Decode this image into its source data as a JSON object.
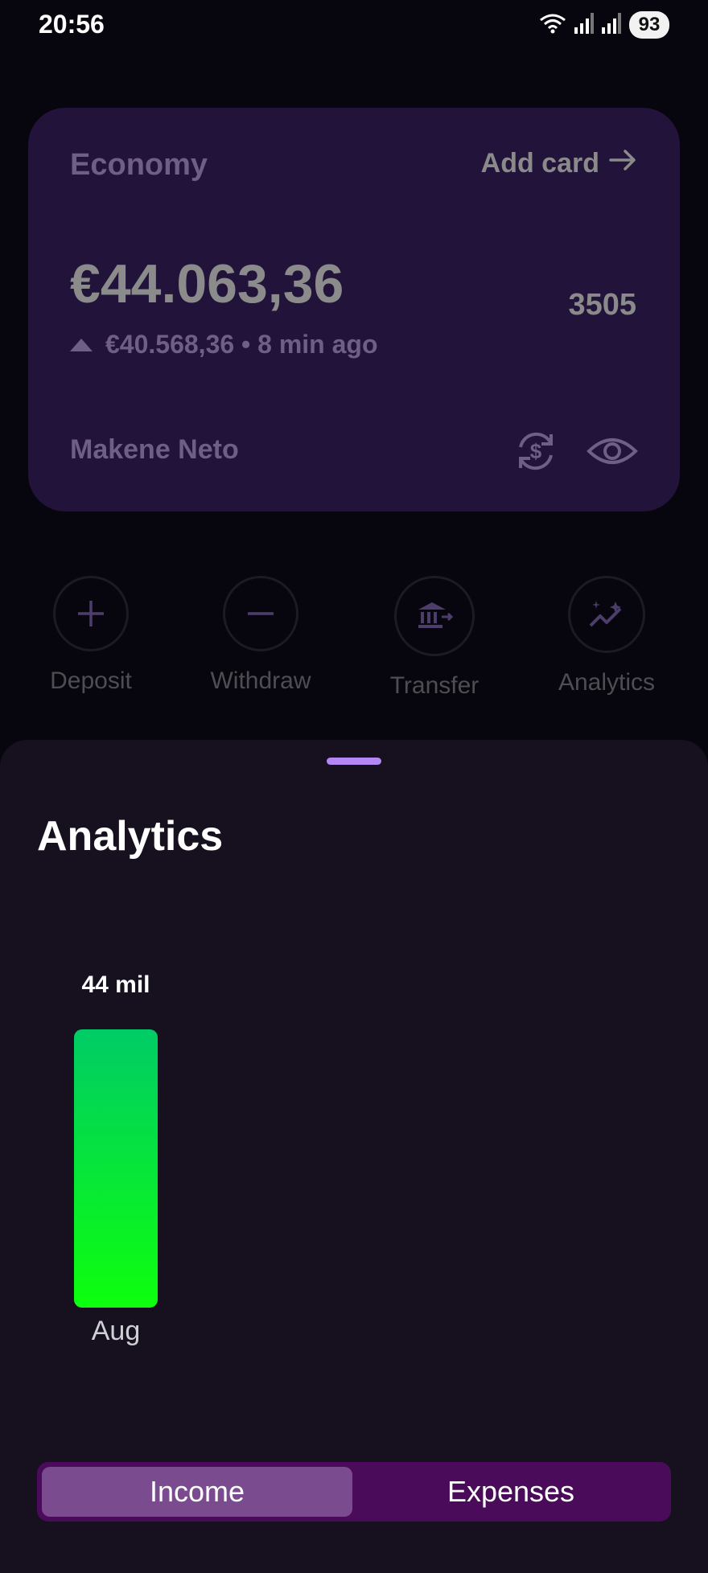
{
  "status_bar": {
    "time": "20:56",
    "battery": "93"
  },
  "card": {
    "title": "Economy",
    "add_card_label": "Add card",
    "balance": "€44.063,36",
    "change_text": "€40.568,36 • 8 min ago",
    "card_number": "3505",
    "holder": "Makene Neto"
  },
  "actions": [
    {
      "label": "Deposit",
      "icon": "plus-icon"
    },
    {
      "label": "Withdraw",
      "icon": "minus-icon"
    },
    {
      "label": "Transfer",
      "icon": "bank-transfer-icon"
    },
    {
      "label": "Analytics",
      "icon": "sparkle-chart-icon"
    }
  ],
  "analytics": {
    "title": "Analytics",
    "tabs": {
      "income": "Income",
      "expenses": "Expenses",
      "selected": "Income"
    }
  },
  "chart_data": {
    "type": "bar",
    "categories": [
      "Aug"
    ],
    "values": [
      44
    ],
    "data_labels": [
      "44 mil"
    ],
    "ylim": [
      0,
      44
    ],
    "colors": {
      "bar_top": "#00cc66",
      "bar_bottom": "#0dff0d"
    }
  },
  "colors": {
    "background": "#07060e",
    "card": "#22133a",
    "sheet": "#16101f",
    "accent": "#b388f5",
    "toggle_bg": "#4a0c5a",
    "toggle_selected": "#7b4b8f"
  }
}
